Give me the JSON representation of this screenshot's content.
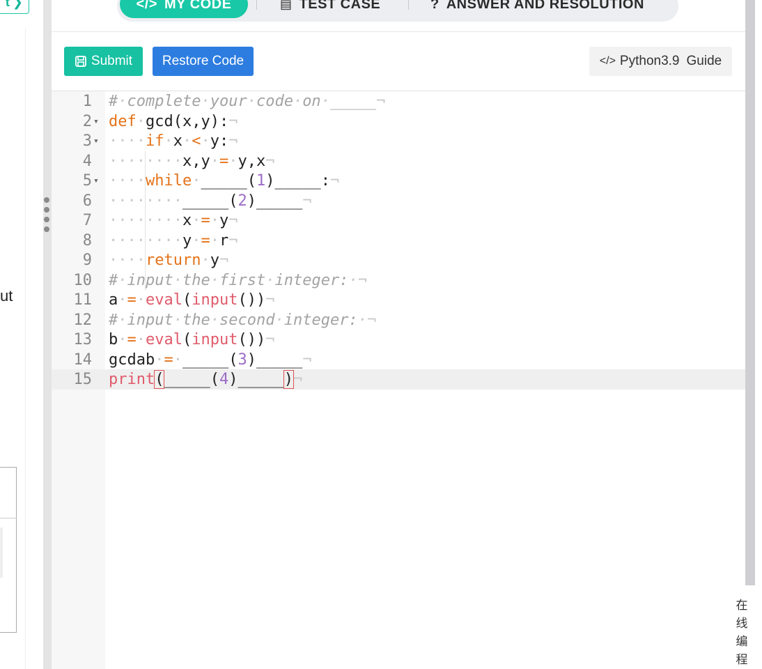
{
  "left_panel": {
    "next_label": "t",
    "partial_text": "ut"
  },
  "tabs": [
    {
      "icon": "code-icon",
      "label": "MY CODE",
      "active": true
    },
    {
      "icon": "list-icon",
      "label": "TEST CASE",
      "active": false
    },
    {
      "icon": "question-icon",
      "label": "ANSWER AND RESOLUTION",
      "active": false
    }
  ],
  "toolbar": {
    "submit_label": "Submit",
    "restore_label": "Restore Code",
    "language_label": "Python3.9",
    "guide_label": "Guide"
  },
  "editor": {
    "active_line": 15,
    "lines": [
      "# complete your code on _____",
      "def gcd(x,y):",
      "    if x < y:",
      "        x,y = y,x",
      "    while _____(1)_____:",
      "        _____(2)_____",
      "        x = y",
      "        y = r",
      "    return y",
      "# input the first integer: ",
      "a = eval(input())",
      "# input the second integer: ",
      "b = eval(input())",
      "gcdab = _____(3)_____",
      "print(_____(4)_____)"
    ]
  },
  "side_tab": {
    "chars": [
      "在",
      "线",
      "编",
      "程"
    ]
  },
  "colors": {
    "accent": "#18c8a6",
    "primary": "#2d7de0",
    "keyword": "#e4731a",
    "builtin": "#e05b6b",
    "number": "#9d6cc7",
    "comment": "#a3a3a3"
  }
}
